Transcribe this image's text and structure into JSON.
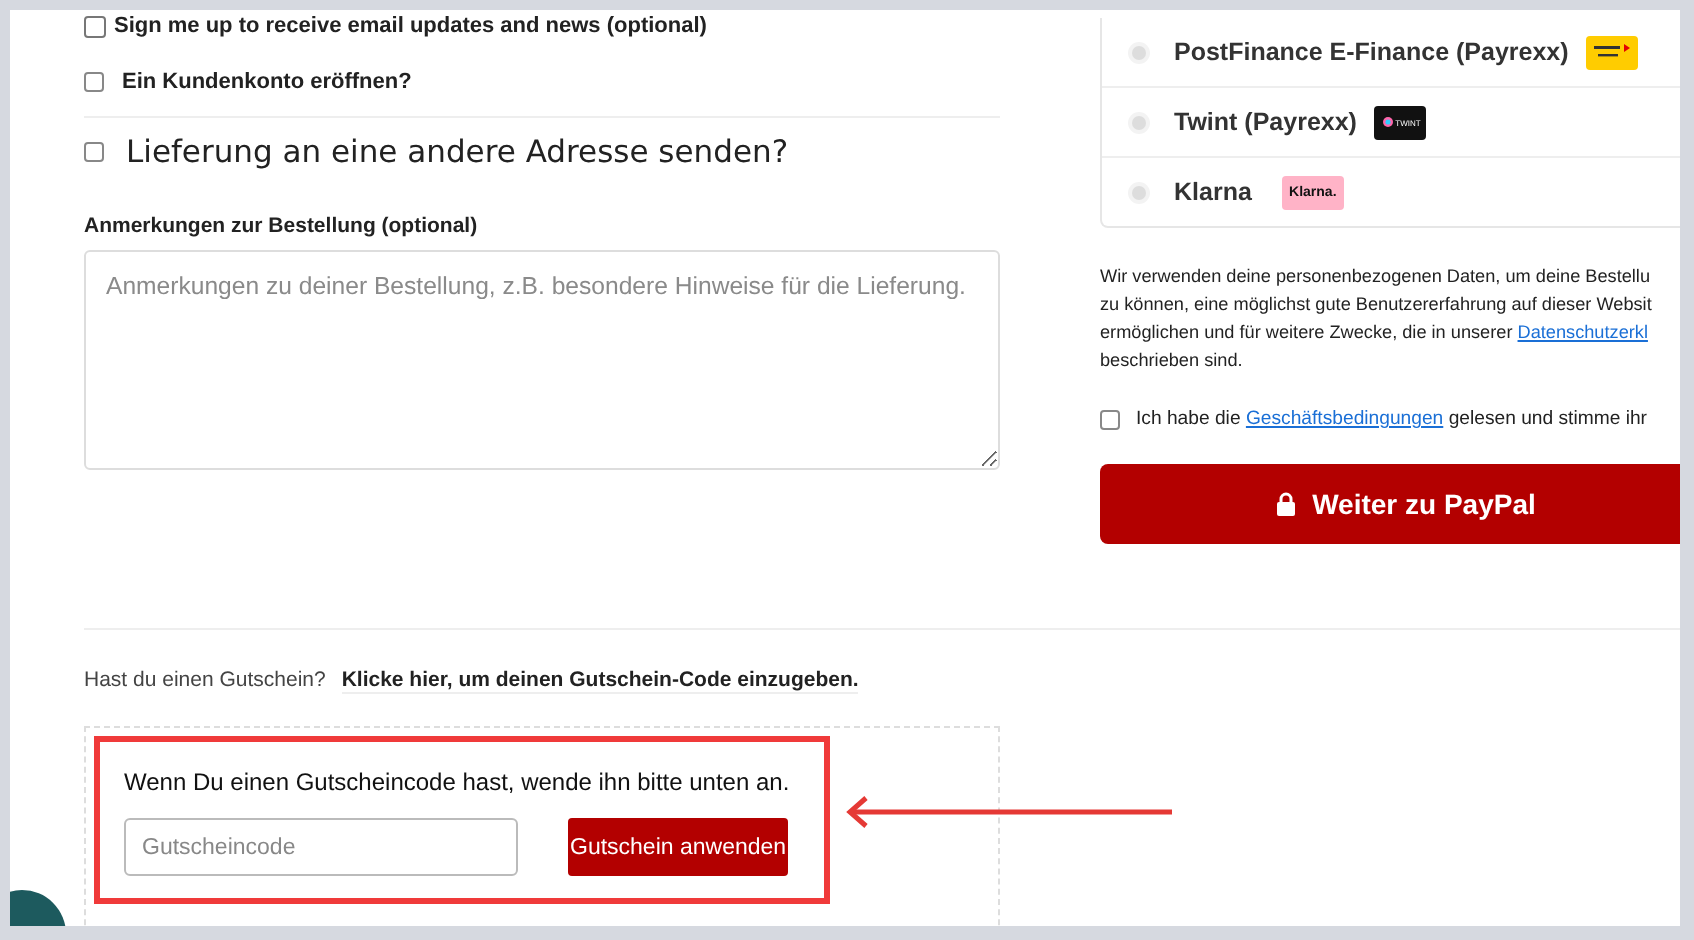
{
  "checkboxes": [
    {
      "label": "Sign me up to receive email updates and news (optional)",
      "checked": false,
      "kind": "native"
    },
    {
      "label": "Ein Kundenkonto eröffnen?",
      "checked": false,
      "kind": "styled"
    }
  ],
  "shipping_toggle": {
    "label": "Lieferung an eine andere Adresse senden?",
    "checked": false
  },
  "notes": {
    "label": "Anmerkungen zur Bestellung (optional)",
    "placeholder": "Anmerkungen zu deiner Bestellung, z.B. besondere Hinweise für die Lieferung."
  },
  "payment_methods": [
    {
      "name": "PostFinance E-Finance (Payrexx)",
      "selected": false,
      "kind": "postfinance"
    },
    {
      "name": "Twint (Payrexx)",
      "selected": false,
      "kind": "twint",
      "logo_text": "TWINT"
    },
    {
      "name": "Klarna",
      "selected": false,
      "kind": "klarna",
      "logo_text": "Klarna."
    }
  ],
  "privacy_notice": {
    "lines": [
      {
        "text": "Wir verwenden deine personenbezogenen Daten, um deine Bestellu"
      },
      {
        "text": "zu können, eine möglichst gute Benutzererfahrung auf dieser Websit"
      },
      {
        "text": "ermöglichen und für weitere Zwecke, die in unserer",
        "link": "Datenschutzerkl"
      },
      {
        "text": "beschrieben sind."
      }
    ]
  },
  "terms": {
    "checked": false,
    "before": "Ich habe die",
    "link": "Geschäftsbedingungen",
    "after": "gelesen und stimme ihr"
  },
  "checkout_button": {
    "label": "Weiter zu PayPal"
  },
  "coupon": {
    "prompt": "Hast du einen Gutschein?",
    "link": "Klicke hier, um deinen Gutschein-Code einzugeben.",
    "hint": "Wenn Du einen Gutscheincode hast, wende ihn bitte unten an.",
    "placeholder": "Gutscheincode",
    "button": "Gutschein anwenden"
  }
}
